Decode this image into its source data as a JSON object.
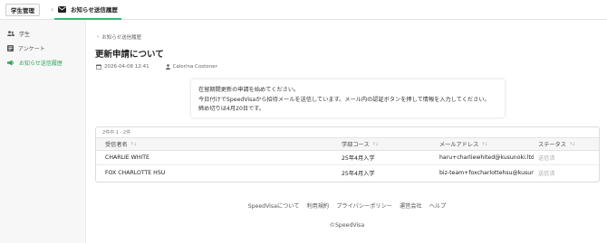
{
  "header": {
    "brand": "学生管理",
    "tab_label": "お知らせ送信履歴"
  },
  "sidebar": {
    "items": [
      {
        "label": "学生"
      },
      {
        "label": "アンケート"
      },
      {
        "label": "お知らせ送信履歴"
      }
    ]
  },
  "main": {
    "back_label": "お知らせ送信履歴",
    "title": "更新申請について",
    "date": "2026-04-08 12:41",
    "sender": "Calorina Costoner",
    "message_lines": [
      "在留期間更新の申請を始めてください。",
      "今日付けでSpeedVisaから招待メールを送信しています。メール内の認証ボタンを押して情報を入力してください。",
      "締め切りは4月20日です。"
    ],
    "count": "2件中 1 - 2件",
    "columns": [
      "受信者名",
      "学部コース",
      "メールアドレス",
      "ステータス"
    ],
    "rows": [
      {
        "name": "CHARLIE WHITE",
        "course": "25年4月入学",
        "email": "haru+charliewhited@kusunoki.ltd",
        "status": "送信済"
      },
      {
        "name": "FOX CHARLOTTE HSU",
        "course": "25年4月入学",
        "email": "biz-team+foxcharlottehsu@kusun...",
        "status": "送信済"
      }
    ]
  },
  "footer": {
    "links": [
      "SpeedVisaについて",
      "利用規約",
      "プライバシーポリシー",
      "運営会社",
      "ヘルプ"
    ],
    "copyright": "©SpeedVisa"
  },
  "colors": {
    "accent": "#2aa35a",
    "tab_underline": "#3bb86e",
    "sidebar_bg": "#f7f7f7"
  }
}
